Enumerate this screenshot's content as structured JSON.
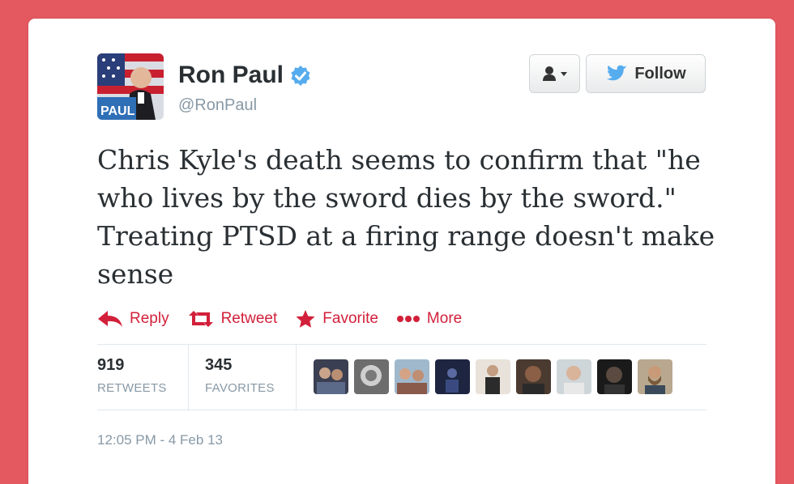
{
  "user": {
    "name": "Ron Paul",
    "handle": "@RonPaul"
  },
  "buttons": {
    "follow_label": "Follow"
  },
  "tweet": {
    "text": "Chris Kyle's death seems to confirm that \"he who lives by the sword dies by the sword.\" Treating PTSD at a firing range doesn't make sense",
    "timestamp": "12:05 PM - 4 Feb 13"
  },
  "actions": {
    "reply": "Reply",
    "retweet": "Retweet",
    "favorite": "Favorite",
    "more": "More"
  },
  "stats": {
    "retweets_count": "919",
    "retweets_label": "RETWEETS",
    "favorites_count": "345",
    "favorites_label": "FAVORITES"
  },
  "colors": {
    "background": "#e4585f",
    "action_red": "#d2203a",
    "verified_blue": "#55acee",
    "twitter_blue": "#55acee"
  }
}
